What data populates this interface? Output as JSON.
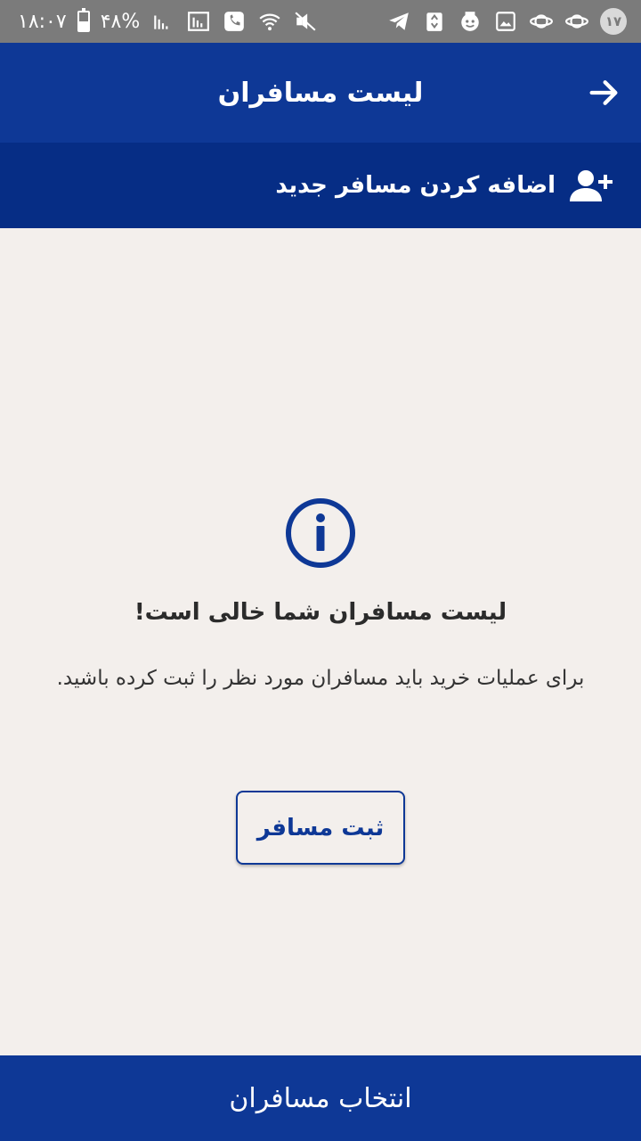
{
  "status_bar": {
    "time": "۱۸:۰۷",
    "battery_percent": "۴۸%",
    "battery_level": 0.48,
    "notification_count": "۱۷",
    "left_icons": [
      "battery-icon",
      "signal-icon",
      "signal-icon-2",
      "phone-call-icon",
      "wifi-icon",
      "mute-icon"
    ],
    "right_icons": [
      "telegram-icon",
      "recycle-icon",
      "app-icon",
      "image-icon",
      "saturn-icon",
      "saturn-icon-2"
    ]
  },
  "header": {
    "title": "لیست مسافران",
    "back_icon": "arrow-right-icon"
  },
  "add_passenger": {
    "label": "اضافه کردن مسافر جدید",
    "icon": "add-person-icon"
  },
  "empty_state": {
    "icon": "info-icon",
    "title": "لیست مسافران شما خالی است!",
    "description": "برای عملیات خرید باید مسافران مورد نظر را ثبت کرده باشید.",
    "button_label": "ثبت مسافر"
  },
  "footer": {
    "button_label": "انتخاب مسافران"
  },
  "colors": {
    "primary": "#0e3896",
    "primary_dark": "#062d85",
    "background": "#f3efec",
    "status_bar": "#7b7b7b"
  }
}
